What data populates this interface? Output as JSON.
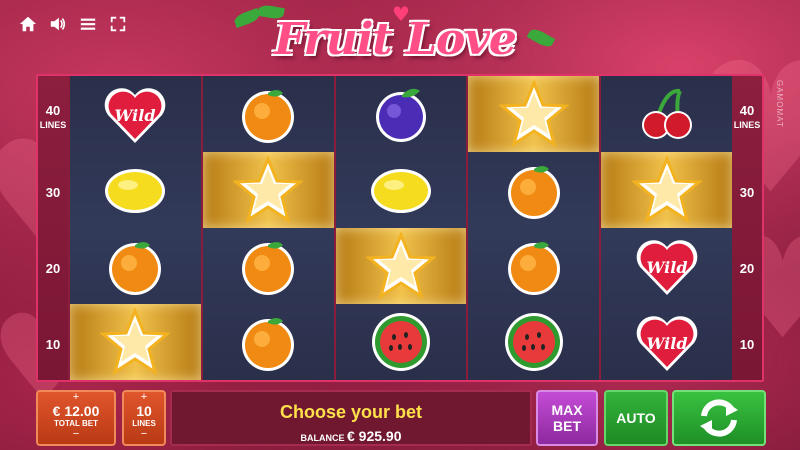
{
  "logo": {
    "text": "Fruit Love"
  },
  "topbar": {
    "icons": [
      "home-icon",
      "sound-icon",
      "menu-icon",
      "fullscreen-icon"
    ]
  },
  "lines_left": [
    {
      "num": "40",
      "label": "LINES"
    },
    {
      "num": "30"
    },
    {
      "num": "20"
    },
    {
      "num": "10"
    }
  ],
  "lines_right": [
    {
      "num": "40",
      "label": "LINES"
    },
    {
      "num": "30"
    },
    {
      "num": "20"
    },
    {
      "num": "10"
    }
  ],
  "brand": "GAMOMAT",
  "reels": [
    [
      "wild",
      "lemon",
      "orange",
      "star"
    ],
    [
      "orange",
      "star",
      "orange",
      "orange"
    ],
    [
      "plum",
      "lemon",
      "star",
      "watermelon"
    ],
    [
      "star",
      "orange",
      "orange",
      "watermelon"
    ],
    [
      "cherry",
      "star",
      "wild",
      "wild"
    ]
  ],
  "symbols": {
    "wild_text": "Wild"
  },
  "controls": {
    "total_bet": {
      "plus": "+",
      "value": "€ 12.00",
      "label": "TOTAL BET",
      "minus": "−"
    },
    "lines": {
      "plus": "+",
      "value": "10",
      "label": "LINES",
      "minus": "−"
    },
    "message": "Choose your bet",
    "balance_label": "BALANCE",
    "balance_value": "€ 925.90",
    "max_bet_line1": "MAX",
    "max_bet_line2": "BET",
    "auto": "AUTO"
  },
  "colors": {
    "accent": "#e0326a",
    "message": "#ffe14a",
    "spin": "#2fb236"
  }
}
